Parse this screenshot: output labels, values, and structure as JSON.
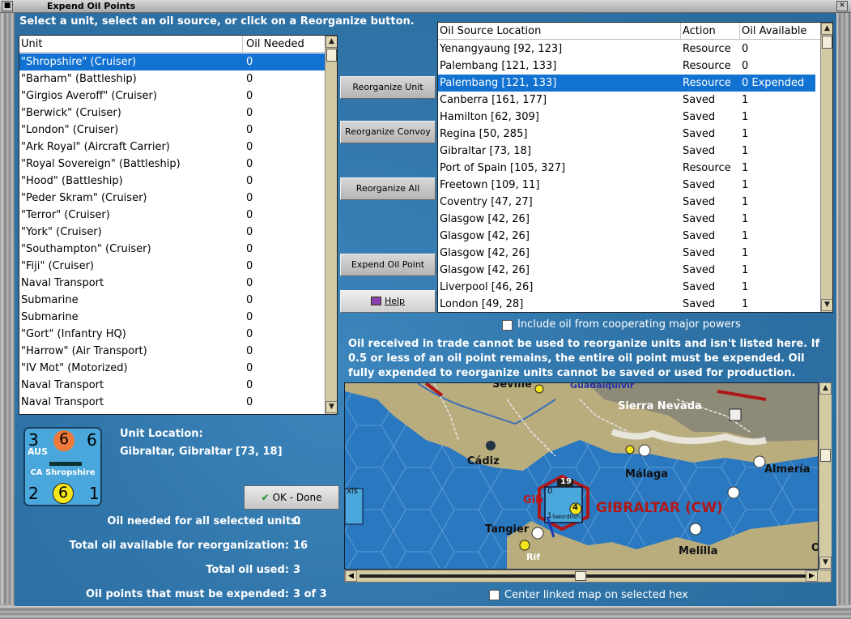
{
  "window": {
    "title": "Expend Oil Points"
  },
  "instruction": "Select a unit, select an oil source, or click on a Reorganize button.",
  "units_table": {
    "headers": [
      "Unit",
      "Oil Needed"
    ],
    "rows": [
      {
        "unit": "\"Shropshire\" (Cruiser)",
        "oil": "0",
        "selected": true
      },
      {
        "unit": "\"Barham\" (Battleship)",
        "oil": "0"
      },
      {
        "unit": "\"Girgios Averoff\" (Cruiser)",
        "oil": "0"
      },
      {
        "unit": "\"Berwick\" (Cruiser)",
        "oil": "0"
      },
      {
        "unit": "\"London\" (Cruiser)",
        "oil": "0"
      },
      {
        "unit": "\"Ark Royal\" (Aircraft Carrier)",
        "oil": "0"
      },
      {
        "unit": "\"Royal Sovereign\" (Battleship)",
        "oil": "0"
      },
      {
        "unit": "\"Hood\" (Battleship)",
        "oil": "0"
      },
      {
        "unit": "\"Peder Skram\" (Cruiser)",
        "oil": "0"
      },
      {
        "unit": "\"Terror\" (Cruiser)",
        "oil": "0"
      },
      {
        "unit": "\"York\" (Cruiser)",
        "oil": "0"
      },
      {
        "unit": "\"Southampton\" (Cruiser)",
        "oil": "0"
      },
      {
        "unit": "\"Fiji\" (Cruiser)",
        "oil": "0"
      },
      {
        "unit": "Naval Transport",
        "oil": "0"
      },
      {
        "unit": "Submarine",
        "oil": "0"
      },
      {
        "unit": "Submarine",
        "oil": "0"
      },
      {
        "unit": "\"Gort\" (Infantry HQ)",
        "oil": "0"
      },
      {
        "unit": "\"Harrow\" (Air Transport)",
        "oil": "0"
      },
      {
        "unit": "\"IV Mot\" (Motorized)",
        "oil": "0"
      },
      {
        "unit": "Naval Transport",
        "oil": "0"
      },
      {
        "unit": "Naval Transport",
        "oil": "0"
      }
    ]
  },
  "oil_table": {
    "headers": [
      "Oil Source Location",
      "Action",
      "Oil Available"
    ],
    "rows": [
      {
        "loc": "Yenangyaung [92, 123]",
        "action": "Resource",
        "avail": "0"
      },
      {
        "loc": "Palembang [121, 133]",
        "action": "Resource",
        "avail": "0"
      },
      {
        "loc": "Palembang [121, 133]",
        "action": "Resource",
        "avail": "0 Expended",
        "selected": true
      },
      {
        "loc": "Canberra [161, 177]",
        "action": "Saved",
        "avail": "1"
      },
      {
        "loc": "Hamilton [62, 309]",
        "action": "Saved",
        "avail": "1"
      },
      {
        "loc": "Regina [50, 285]",
        "action": "Saved",
        "avail": "1"
      },
      {
        "loc": "Gibraltar [73, 18]",
        "action": "Saved",
        "avail": "1"
      },
      {
        "loc": "Port of Spain [105, 327]",
        "action": "Resource",
        "avail": "1"
      },
      {
        "loc": "Freetown [109, 11]",
        "action": "Saved",
        "avail": "1"
      },
      {
        "loc": "Coventry [47, 27]",
        "action": "Saved",
        "avail": "1"
      },
      {
        "loc": "Glasgow [42, 26]",
        "action": "Saved",
        "avail": "1"
      },
      {
        "loc": "Glasgow [42, 26]",
        "action": "Saved",
        "avail": "1"
      },
      {
        "loc": "Glasgow [42, 26]",
        "action": "Saved",
        "avail": "1"
      },
      {
        "loc": "Glasgow [42, 26]",
        "action": "Saved",
        "avail": "1"
      },
      {
        "loc": "Liverpool [46, 26]",
        "action": "Saved",
        "avail": "1"
      },
      {
        "loc": "London [49, 28]",
        "action": "Saved",
        "avail": "1"
      }
    ]
  },
  "buttons": {
    "reorganize_unit": "Reorganize Unit",
    "reorganize_convoy": "Reorganize Convoy",
    "reorganize_all": "Reorganize All",
    "expend_oil_point": "Expend Oil Point",
    "help": "Help",
    "ok_done": "OK - Done"
  },
  "include_cooperating": "Include oil from cooperating major powers",
  "note": "Oil received in trade cannot be used to reorganize units and isn't listed here.  If 0.5 or less of an oil point remains, the entire oil point must be expended.   Oil fully expended to reorganize units cannot be saved or used for production.",
  "counter": {
    "nation": "AUS",
    "name": "CA Shropshire",
    "top_left": "3",
    "top_mid": "6",
    "top_right": "6",
    "bot_left": "2",
    "bot_mid": "6",
    "bot_right": "1",
    "colors": {
      "body": "#49a7dc",
      "orange": "#f07a3a",
      "yellow": "#f5e61b"
    }
  },
  "unit_location": {
    "label": "Unit Location:",
    "value": "Gibraltar, Gibraltar [73, 18]"
  },
  "summary": [
    {
      "label": "Oil needed for all selected units:",
      "value": "0"
    },
    {
      "label": "Total oil available for reorganization:",
      "value": "16"
    },
    {
      "label": "Total oil used:",
      "value": "3"
    },
    {
      "label": "Oil points that must be expended:",
      "value": "3 of 3"
    }
  ],
  "map": {
    "labels": {
      "seville": "Seville",
      "guadalquivir": "Guadalquivir",
      "sierra_nevada": "Sierra Nevada",
      "cadiz": "Cádiz",
      "malaga": "Málaga",
      "almeria": "Almería",
      "gibraltar": "GIBRALTAR (CW)",
      "gib": "Gib",
      "tangier": "Tangier",
      "rif": "Rif",
      "melilla": "Melilla",
      "edge_o": "O",
      "stack_count": "19",
      "unit_name": "Swordfish",
      "unit_value": "4",
      "unit_zero": "0",
      "unit_one": "1",
      "axis": "xis"
    }
  },
  "center_linked": "Center linked map on selected hex"
}
